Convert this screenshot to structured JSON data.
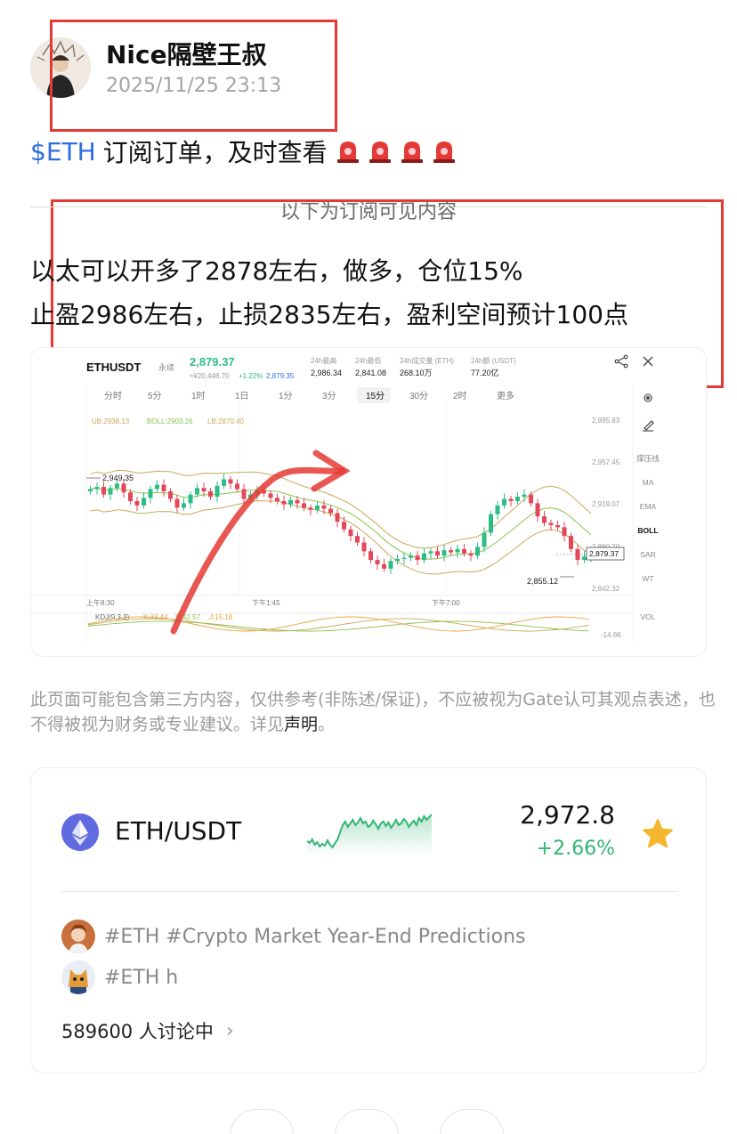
{
  "author": {
    "name": "Nice隔壁王叔",
    "timestamp": "2025/11/25 23:13"
  },
  "post": {
    "tag": "$ETH",
    "title": "订阅订单，及时查看",
    "subscriber_divider": "以下为订阅可见内容",
    "body_line1": "以太可以开多了2878左右，做多，仓位15%",
    "body_line2": "止盈2986左右，止损2835左右，盈利空间预计100点"
  },
  "embedded_chart": {
    "symbol": "ETHUSDT",
    "contract_type": "永续",
    "last_price": "2,879.37",
    "sub_price": "≈¥20,448.70",
    "change_pct": "+1.22%",
    "mark_price": "2,879.35",
    "stats": [
      {
        "label": "24h最高",
        "value": "2,986.34"
      },
      {
        "label": "24h最低",
        "value": "2,841.08"
      },
      {
        "label": "24h成交量 (ETH)",
        "value": "268.10万"
      },
      {
        "label": "24h额 (USDT)",
        "value": "77.20亿"
      }
    ],
    "timeframes": [
      "分时",
      "5分",
      "1时",
      "1日",
      "1分",
      "3分",
      "15分",
      "30分",
      "2时",
      "更多"
    ],
    "active_timeframe": "15分",
    "boll_legend": {
      "ub": "UB:2938.13",
      "boll": "BOLL:2903.26",
      "lb": "LB:2870.40"
    },
    "y_ticks": [
      "2,995.83",
      "2,957.45",
      "2,919.07",
      "2,880.70",
      "2,842.32"
    ],
    "x_ticks": [
      "上午8:30",
      "下午1:45",
      "下午7:00"
    ],
    "high_marker": "2,949.35",
    "low_marker": "2,855.12",
    "current_marker": "2,879.37",
    "kdj_legend": {
      "label": "KDJ(9,3,3)",
      "k": "K:33.44",
      "d": "D:42.57",
      "j": "J:15.18"
    },
    "kdj_tick": "-14.86",
    "indicators": [
      "撑压线",
      "MA",
      "EMA",
      "BOLL",
      "SAR",
      "WT",
      "VOL"
    ],
    "active_indicator": "BOLL",
    "colors": {
      "up": "#2ebd85",
      "down": "#e5475a",
      "boll_mid": "#8bc34a",
      "boll_band": "#c9a85c",
      "annotation": "#e53935"
    }
  },
  "disclaimer": {
    "text": "此页面可能包含第三方内容，仅供参考(非陈述/保证)，不应被视为Gate认可其观点表述，也不得被视为财务或专业建议。详见",
    "link": "声明",
    "end": "。"
  },
  "market": {
    "pair": "ETH/USDT",
    "price": "2,972.8",
    "change": "+2.66%",
    "favorited": true,
    "topics": [
      {
        "text": "#ETH #Crypto Market Year-End Predictions"
      },
      {
        "text": "#ETH h"
      }
    ],
    "discussion": "589600 人讨论中"
  }
}
